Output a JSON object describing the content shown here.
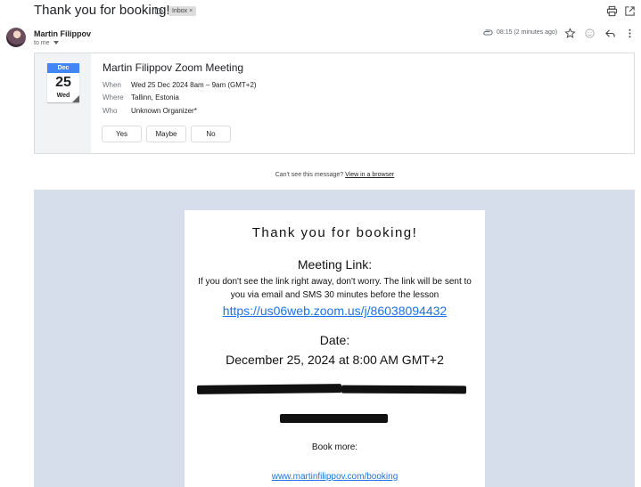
{
  "header": {
    "subject": "Thank you for booking!",
    "label_chip": "Inbox",
    "label_chip_close": "×",
    "icons": [
      "label-icon",
      "print-icon",
      "open-in-new-window-icon"
    ]
  },
  "message": {
    "sender_name": "Martin Filippov",
    "to_line": "to me",
    "timestamp": "08:15 (2 minutes ago)",
    "action_icons": [
      "attachment-icon",
      "star-icon",
      "emoji-reaction-icon",
      "reply-icon",
      "more-options-icon"
    ]
  },
  "invite": {
    "calendar": {
      "month": "Dec",
      "day": "25",
      "weekday": "Wed"
    },
    "title": "Martin Filippov Zoom Meeting",
    "details": [
      {
        "label": "When",
        "value": "Wed 25 Dec 2024 8am – 9am (GMT+2)"
      },
      {
        "label": "Where",
        "value": "Tallinn, Estonia"
      },
      {
        "label": "Who",
        "value": "Unknown Organizer*"
      }
    ],
    "rsvp": {
      "yes": "Yes",
      "maybe": "Maybe",
      "no": "No"
    }
  },
  "view_in_browser": {
    "prefix": "Can't see this message?",
    "link": "View in a browser"
  },
  "email_body": {
    "heading": "Thank you for booking!",
    "meeting_link_heading": "Meeting Link:",
    "info_text": "If you don't see the link right away, don't worry. The link will be sent to you via email and SMS 30 minutes before the lesson",
    "meeting_url": "https://us06web.zoom.us/j/86038094432",
    "date_heading": "Date:",
    "date_value": "December 25, 2024 at 8:00 AM GMT+2",
    "book_more": "Book more:",
    "booking_url": "www.martinfilippov.com/booking"
  },
  "colors": {
    "link": "#1a73e8",
    "calendar_header": "#4285f4",
    "body_background": "#d7deeb",
    "redaction": "#111111"
  }
}
